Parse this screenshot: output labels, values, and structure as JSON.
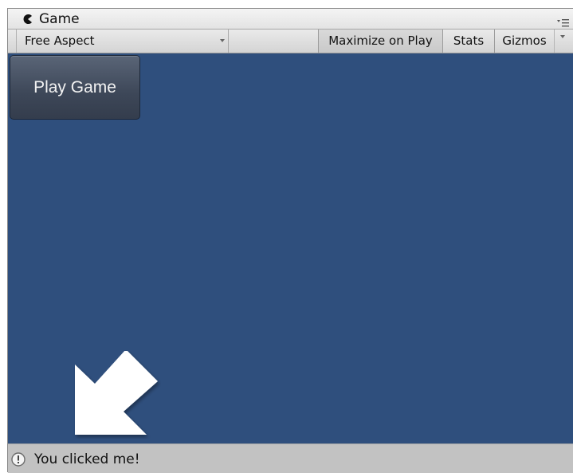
{
  "window": {
    "tab_title": "Game",
    "tab_icon": "pacman-game-icon",
    "menu_icon": "tab-menu-icon"
  },
  "toolbar": {
    "aspect_label": "Free Aspect",
    "maximize_label": "Maximize on Play",
    "stats_label": "Stats",
    "gizmos_label": "Gizmos"
  },
  "viewport": {
    "background_color": "#2f4f7d",
    "play_button_label": "Play Game",
    "pointer_icon": "arrow-down-left-icon"
  },
  "status": {
    "icon": "info-icon",
    "message": "You clicked me!"
  }
}
